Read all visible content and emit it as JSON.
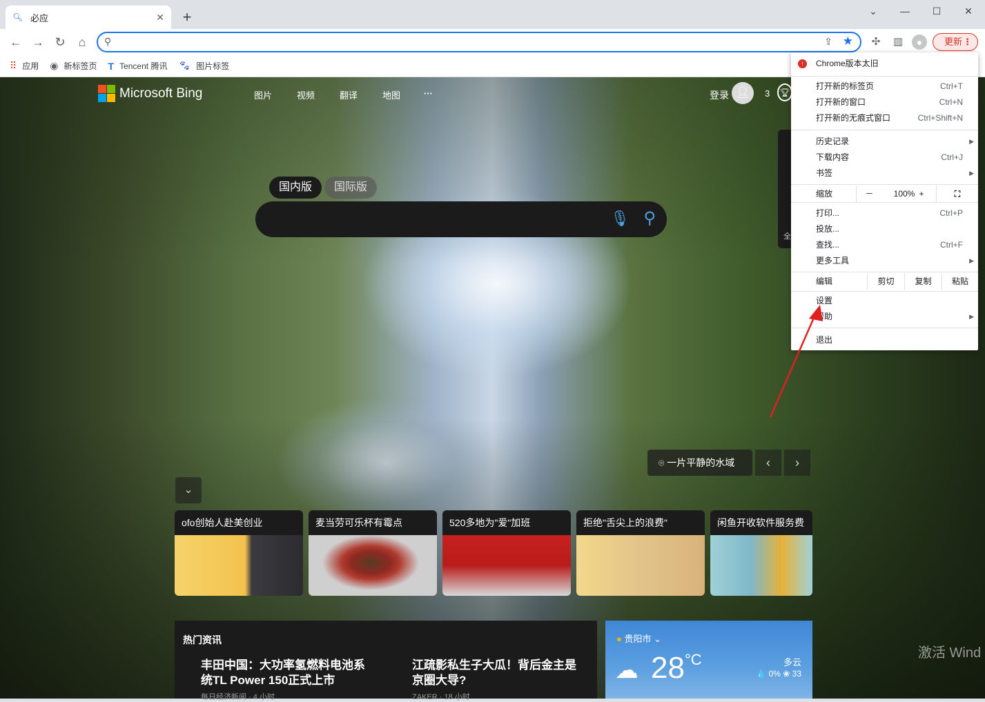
{
  "browser": {
    "tab_title": "必应",
    "search_icon": "search-icon",
    "update_label": "更新",
    "bookmarks": [
      {
        "label": "应用",
        "icon": "apps-grid-icon"
      },
      {
        "label": "新标签页",
        "icon": "globe-icon"
      },
      {
        "label": "Tencent 腾讯",
        "icon": "tencent-icon"
      },
      {
        "label": "图片标签",
        "icon": "paw-icon"
      }
    ]
  },
  "bing": {
    "logo_text": "Microsoft Bing",
    "nav": [
      "图片",
      "视频",
      "翻译",
      "地图",
      "···"
    ],
    "login": "登录",
    "points": "3",
    "scope_tabs": [
      "国内版",
      "国际版"
    ],
    "side_text": "全",
    "caption": "一片平静的水域",
    "cards": [
      {
        "title": "ofo创始人赴美创业",
        "color": "#f3c24d"
      },
      {
        "title": "麦当劳可乐杯有霉点",
        "color": "#8c2a22"
      },
      {
        "title": "520多地为\"爱\"加班",
        "color": "#c6201f"
      },
      {
        "title": "拒绝\"舌尖上的浪费\"",
        "color": "#e2c48a"
      },
      {
        "title": "闲鱼开收软件服务费",
        "color": "#7fb8c8"
      }
    ],
    "news_heading": "热门资讯",
    "news": [
      {
        "title": "丰田中国：大功率氢燃料电池系统TL Power 150正式上市",
        "source": "每日经济新闻 · 4 小时"
      },
      {
        "title": "江疏影私生子大瓜！背后金主是京圈大导?",
        "source": "ZAKER · 18 小时"
      }
    ],
    "weather": {
      "city": "贵阳市",
      "temp": "28",
      "unit": "°C",
      "condition": "多云",
      "precip": "0%",
      "aqi": "33"
    },
    "watermark": "激活 Wind"
  },
  "menu": {
    "update_row": "Chrome版本太旧",
    "new_tab": {
      "label": "打开新的标签页",
      "shortcut": "Ctrl+T"
    },
    "new_window": {
      "label": "打开新的窗口",
      "shortcut": "Ctrl+N"
    },
    "incognito": {
      "label": "打开新的无痕式窗口",
      "shortcut": "Ctrl+Shift+N"
    },
    "history": "历史记录",
    "downloads": {
      "label": "下载内容",
      "shortcut": "Ctrl+J"
    },
    "bookmarks": "书签",
    "zoom_label": "缩放",
    "zoom_minus": "－",
    "zoom_value": "100%",
    "zoom_plus": "+",
    "print": {
      "label": "打印...",
      "shortcut": "Ctrl+P"
    },
    "cast": "投放...",
    "find": {
      "label": "查找...",
      "shortcut": "Ctrl+F"
    },
    "more_tools": "更多工具",
    "edit_label": "编辑",
    "cut": "剪切",
    "copy": "复制",
    "paste": "粘贴",
    "settings": "设置",
    "help": "帮助",
    "exit": "退出"
  }
}
